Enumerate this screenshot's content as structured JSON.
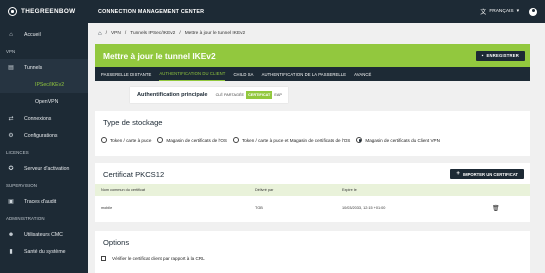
{
  "brand": {
    "logo_text": "THEGREENBOW"
  },
  "topbar": {
    "title": "CONNECTION MANAGEMENT CENTER",
    "language": "FRANÇAIS",
    "language_icon": "translate-icon",
    "chevron": "⌄"
  },
  "sidebar": {
    "items": [
      {
        "label": "Accueil",
        "icon": "home-icon"
      },
      {
        "section": "VPN"
      },
      {
        "label": "Tunnels",
        "icon": "tunnel-icon"
      },
      {
        "sub": "IPSec/IKEv2"
      },
      {
        "sub": "OpenVPN"
      },
      {
        "label": "Connexions",
        "icon": "connections-icon"
      },
      {
        "label": "Configurations",
        "icon": "gear-icon"
      },
      {
        "section": "LICENCES"
      },
      {
        "label": "Serveur d'activation",
        "icon": "server-icon"
      },
      {
        "section": "SUPERVISION"
      },
      {
        "label": "Traces d'audit",
        "icon": "audit-icon"
      },
      {
        "section": "ADMINISTRATION"
      },
      {
        "label": "Utilisateurs CMC",
        "icon": "users-icon"
      },
      {
        "label": "Santé du système",
        "icon": "health-icon"
      }
    ]
  },
  "breadcrumb": {
    "parts": [
      "VPN",
      "Tunnels IPSec/IKEv2",
      "Mettre à jour le tunnel IKEv2"
    ],
    "sep": "/"
  },
  "header": {
    "title": "Mettre à jour le tunnel IKEv2",
    "save_label": "ENREGISTRER"
  },
  "tabs": [
    "PASSERELLE DISTANTE",
    "AUTHENTIFICATION DU CLIENT",
    "CHILD SA",
    "AUTHENTIFICATION DE LA PASSERELLE",
    "AVANCÉ"
  ],
  "auth": {
    "label": "Authentification principale",
    "options": [
      "CLÉ PARTAGÉE",
      "CERTIFICAT",
      "EAP"
    ],
    "selected": 1
  },
  "storage": {
    "title": "Type de stockage",
    "options": [
      "Token / carte à puce",
      "Magasin de certificats de l'OS",
      "Token / carte à puce et Magasin de certificats de l'OS",
      "Magasin de certificats du Client VPN"
    ],
    "selected": 3
  },
  "pkcs12": {
    "title": "Certificat PKCS12",
    "import_label": "IMPORTER UN CERTIFICAT",
    "columns": [
      "Nom commun du certificat",
      "Délivré par",
      "Expire le"
    ],
    "rows": [
      {
        "name": "mobile",
        "issuer": "TGB",
        "expires": "10/03/2033, 12:15 +01:00"
      }
    ]
  },
  "options": {
    "title": "Options",
    "checkbox_label": "Vérifier le certificat client par rapport à la CRL"
  },
  "colors": {
    "accent": "#92c83e",
    "dark": "#1d2a35"
  }
}
